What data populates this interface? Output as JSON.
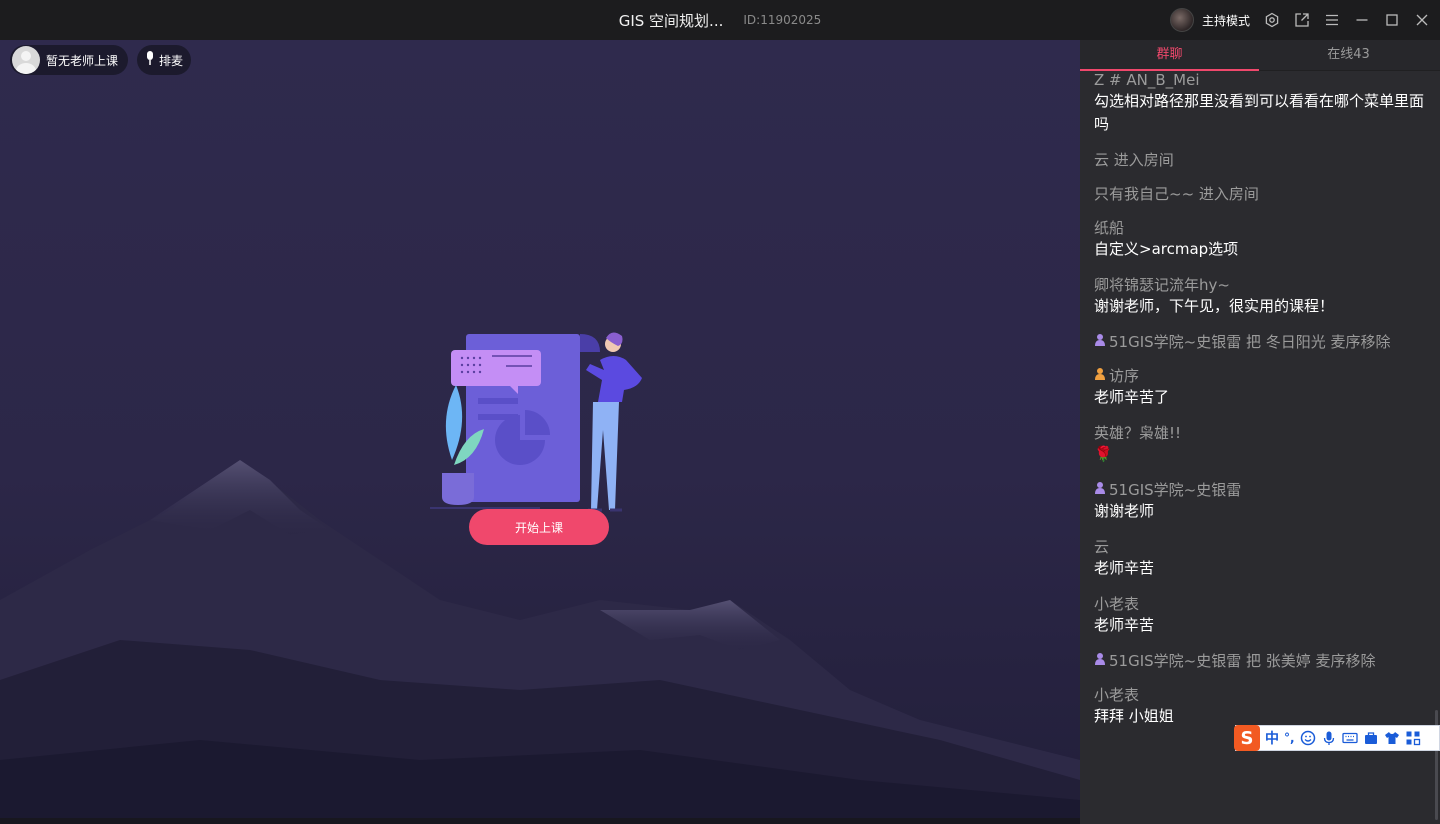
{
  "window": {
    "title": "GIS 空间规划...",
    "room_id": "ID:11902025",
    "mode_label": "主持模式",
    "icons": [
      "settings-icon",
      "popout-icon",
      "menu-icon",
      "minimize-icon",
      "maximize-icon",
      "close-icon"
    ]
  },
  "stage": {
    "teacher_status": "暂无老师上课",
    "queue_label": "排麦",
    "start_button": "开始上课"
  },
  "chat": {
    "tabs": [
      {
        "label": "群聊",
        "active": true
      },
      {
        "label": "在线43",
        "active": false
      }
    ],
    "messages": [
      {
        "who": "Z # AN_B_Mei",
        "text": "勾选相对路径那里没看到可以看看在哪个菜单里面吗"
      },
      {
        "who": "云 进入房间",
        "text": ""
      },
      {
        "who": "只有我自己~~ 进入房间",
        "text": ""
      },
      {
        "who": "纸船",
        "text": "自定义>arcmap选项"
      },
      {
        "who": "卿将锦瑟记流年hy~",
        "text": "谢谢老师，下午见，很实用的课程！"
      },
      {
        "who": "51GIS学院~史银雷 把 冬日阳光 麦序移除",
        "text": "",
        "badge": "purple"
      },
      {
        "who": "访序",
        "text": "老师辛苦了",
        "badge": "orange"
      },
      {
        "who": "英雄？枭雄!!",
        "text": "🌹"
      },
      {
        "who": "51GIS学院~史银雷",
        "text": "谢谢老师",
        "badge": "purple"
      },
      {
        "who": "云",
        "text": "老师辛苦"
      },
      {
        "who": "小老表",
        "text": "老师辛苦"
      },
      {
        "who": "51GIS学院~史银雷 把 张美婷 麦序移除",
        "text": "",
        "badge": "purple"
      },
      {
        "who": "小老表",
        "text": "拜拜 小姐姐"
      }
    ]
  },
  "ime": {
    "logo": "S",
    "mode": "中",
    "punct": "°,"
  }
}
